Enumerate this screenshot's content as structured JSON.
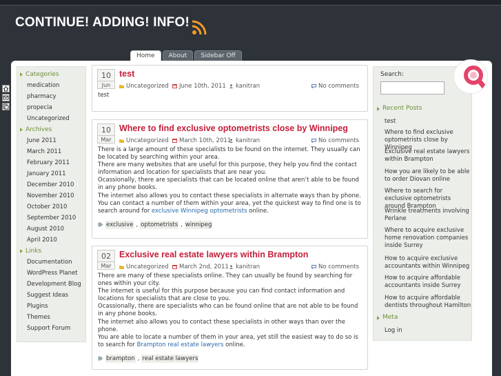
{
  "site": {
    "title": "CONTINUE! ADDING! INFO!",
    "accent": "#c41e3a",
    "green": "#6f8f3a",
    "rss_icon": "rss-feed-icon"
  },
  "nav": {
    "tabs": [
      {
        "label": "Home"
      },
      {
        "label": "About"
      },
      {
        "label": "Sidebar Off"
      }
    ]
  },
  "side_icons": [
    "home-icon",
    "mail-icon",
    "bookmark-icon"
  ],
  "left_sidebar": {
    "categories_title": "Categories",
    "categories": [
      "medication",
      "pharmacy",
      "propecia",
      "Uncategorized"
    ],
    "archives_title": "Archives",
    "archives": [
      "June 2011",
      "March 2011",
      "February 2011",
      "January 2011",
      "December 2010",
      "November 2010",
      "October 2010",
      "September 2010",
      "August 2010",
      "April 2010"
    ],
    "links_title": "Links",
    "links": [
      "Documentation",
      "WordPress Planet",
      "Development Blog",
      "Suggest Ideas",
      "Plugins",
      "Themes",
      "Support Forum"
    ]
  },
  "posts": [
    {
      "day": "10",
      "month": "Jun",
      "title": "test",
      "category": "Uncategorized",
      "date": "June 10th, 2011",
      "author": "kanitran",
      "comments": "No comments",
      "body": [
        "test"
      ]
    },
    {
      "day": "10",
      "month": "Mar",
      "title": "Where to find exclusive optometrists close by Winnipeg",
      "category": "Uncategorized",
      "date": "March 10th, 2011",
      "author": "kanitran",
      "comments": "No comments",
      "body": [
        "There is a large amount of these specialists to be found on the internet. They usually can be located by searching within your area.",
        "There are many websites that are useful for this purpose, they help you find the contact information and location for specialists that are near you.",
        "Ocassionally, there are specialists that can be located online that aren’t able to be found in any phone books.",
        "The internet also allows you to contact these specialists in alternate ways than by phone."
      ],
      "last_before": "You can contact a number of them within your area, yet the quickest way to find one is to search around for ",
      "last_link": "exclusive Winnipeg optometrists",
      "last_after": " online.",
      "tags": [
        "exclusive",
        "optometrists",
        "winnipeg"
      ]
    },
    {
      "day": "02",
      "month": "Mar",
      "title": "Exclusive real estate lawyers within Brampton",
      "category": "Uncategorized",
      "date": "March 2nd, 2011",
      "author": "kanitran",
      "comments": "No comments",
      "body": [
        "There are many of these specialists online. They can usually be found by searching for ones within your city.",
        "The internet is useful for this purpose because you can find contact information and locations for specialists that are close to you.",
        "Ocassionally, there are specialists who can be found online that are not able to be found in any phone books.",
        "The internet also allows you to contact these specialists in other ways than over the phone."
      ],
      "last_before": "You are able to locate a number of them in your area, yet still the easiest way to do so is to search for ",
      "last_link": "Brampton real estate lawyers",
      "last_after": " online.",
      "tags": [
        "brampton",
        "real estate lawyers"
      ]
    }
  ],
  "right_sidebar": {
    "search_label": "Search:",
    "recent_title": "Recent Posts",
    "recent": [
      "test",
      "Where to find exclusive optometrists close by Winnipeg",
      "Exclusive real estate lawyers within Brampton",
      "How you are likely to be able to order Diovan online",
      "Where to search for exclusive optometrists around Brampton",
      "Wrinkle treatments involving Perlane",
      "Where to acquire exclusive home renovation companies inside Surrey",
      "How to acquire exclusive accountants within Winnipeg",
      "How to acquire affordable accountants inside Surrey",
      "How to acquire affordable dentists throughout Hamilton"
    ],
    "meta_title": "Meta",
    "meta": [
      "Log in"
    ]
  }
}
